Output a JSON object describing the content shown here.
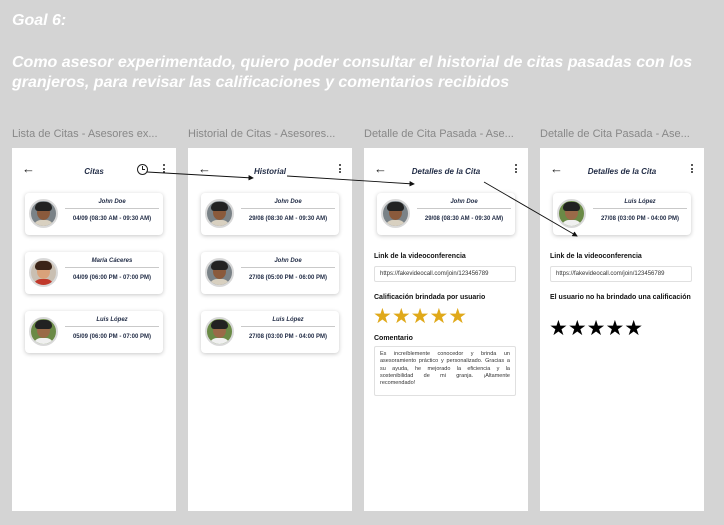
{
  "goal": {
    "title": "Goal 6:",
    "description": "Como asesor experimentado, quiero poder consultar el historial de citas pasadas con los granjeros, para revisar las calificaciones y comentarios recibidos"
  },
  "frames": [
    {
      "label": "Lista de Citas - Asesores ex...",
      "title": "Citas",
      "back": "←",
      "appointments": [
        {
          "name": "John Doe",
          "time": "04/09 (08:30 AM - 09:30 AM)"
        },
        {
          "name": "María Cáceres",
          "time": "04/09 (06:00 PM - 07:00 PM)"
        },
        {
          "name": "Luis López",
          "time": "05/09 (06:00 PM - 07:00 PM)"
        }
      ]
    },
    {
      "label": "Historial de Citas - Asesores...",
      "title": "Historial",
      "back": "←",
      "appointments": [
        {
          "name": "John Doe",
          "time": "29/08 (08:30 AM - 09:30 AM)"
        },
        {
          "name": "John Doe",
          "time": "27/08 (05:00 PM - 06:00 PM)"
        },
        {
          "name": "Luis López",
          "time": "27/08 (03:00 PM - 04:00 PM)"
        }
      ]
    },
    {
      "label": "Detalle de Cita Pasada - Ase...",
      "title": "Detalles de la Cita",
      "back": "←",
      "appointment": {
        "name": "John Doe",
        "time": "29/08 (08:30 AM - 09:30 AM)"
      },
      "link_label": "Link de la videoconferencia",
      "link_value": "https://fakevideocall.com/join/123456789",
      "rating_label": "Calificación brindada por usuario",
      "stars": "★★★★★",
      "rating": 5,
      "comment_label": "Comentario",
      "comment": "Es increíblemente conocedor y brinda un asesoramiento práctico y personalizado. Gracias a su ayuda, he mejorado la eficiencia y la sostenibilidad de mi granja. ¡Altamente recomendado!"
    },
    {
      "label": "Detalle de Cita Pasada - Ase...",
      "title": "Detalles de la Cita",
      "back": "←",
      "appointment": {
        "name": "Luis López",
        "time": "27/08 (03:00 PM - 04:00 PM)"
      },
      "link_label": "Link de la videoconferencia",
      "link_value": "https://fakevideocall.com/join/123456789",
      "no_rating_label": "El usuario no ha brindado una calificación",
      "stars": "★★★★★"
    }
  ],
  "colors": {
    "background": "#d4d4d4",
    "accent_text": "#1f2a44",
    "star_gold": "#e0a91a"
  }
}
